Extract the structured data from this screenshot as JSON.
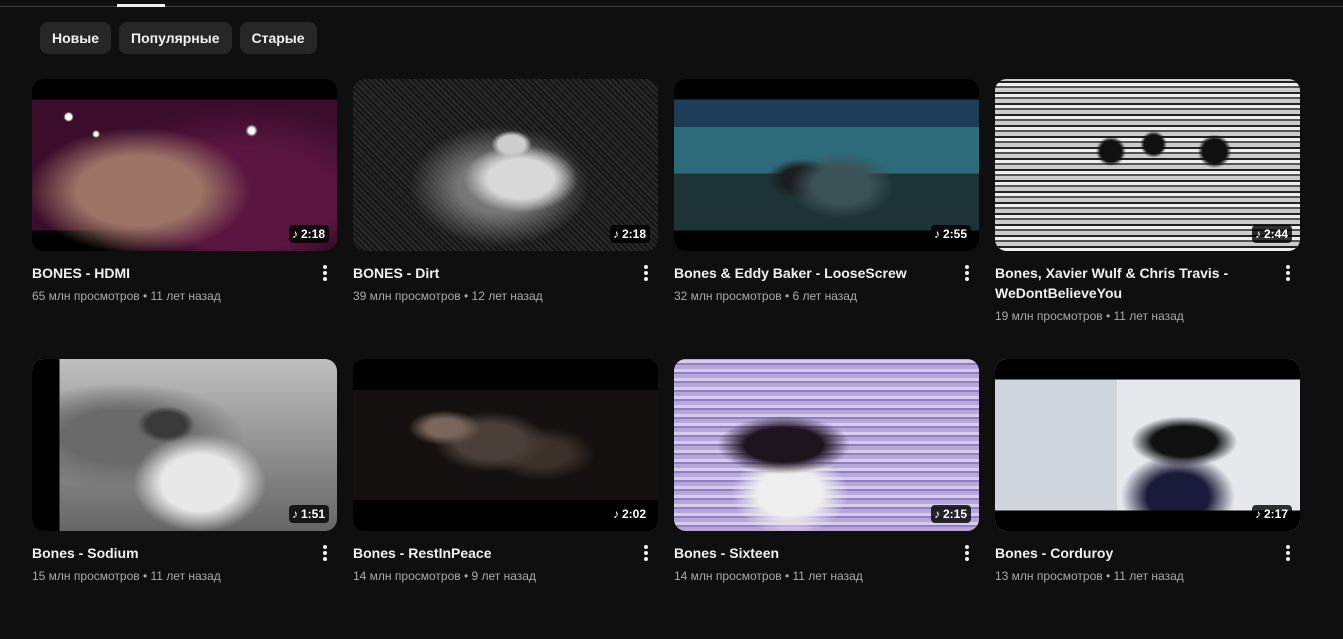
{
  "tabs": {
    "filters": [
      "Новые",
      "Популярные",
      "Старые"
    ]
  },
  "videos": [
    {
      "title": "BONES - HDMI",
      "views": "65 млн просмотров",
      "age": "11 лет назад",
      "duration": "2:18"
    },
    {
      "title": "BONES - Dirt",
      "views": "39 млн просмотров",
      "age": "12 лет назад",
      "duration": "2:18"
    },
    {
      "title": "Bones & Eddy Baker - LooseScrew",
      "views": "32 млн просмотров",
      "age": "6 лет назад",
      "duration": "2:55"
    },
    {
      "title": "Bones, Xavier Wulf & Chris Travis - WeDontBelieveYou",
      "views": "19 млн просмотров",
      "age": "11 лет назад",
      "duration": "2:44"
    },
    {
      "title": "Bones - Sodium",
      "views": "15 млн просмотров",
      "age": "11 лет назад",
      "duration": "1:51"
    },
    {
      "title": "Bones - RestInPeace",
      "views": "14 млн просмотров",
      "age": "9 лет назад",
      "duration": "2:02"
    },
    {
      "title": "Bones - Sixteen",
      "views": "14 млн просмотров",
      "age": "11 лет назад",
      "duration": "2:15"
    },
    {
      "title": "Bones - Corduroy",
      "views": "13 млн просмотров",
      "age": "11 лет назад",
      "duration": "2:17"
    }
  ],
  "separator": "•",
  "icons": {
    "duration": "music-note-icon",
    "menu": "more-vert-icon"
  }
}
